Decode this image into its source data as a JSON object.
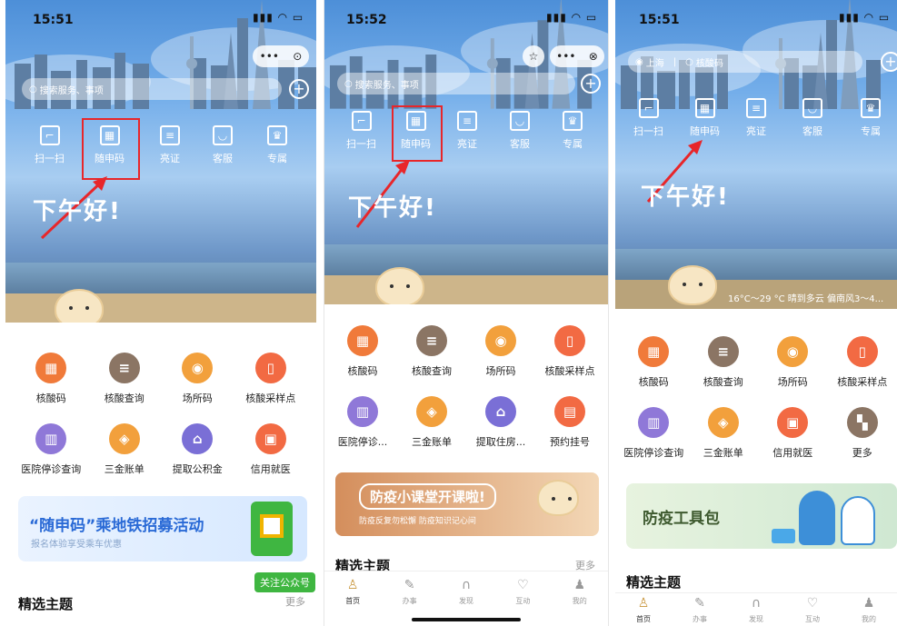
{
  "colors": {
    "highlight": "#e8262a",
    "follow_green": "#3fb641",
    "icon_orange": "#f07a3a",
    "icon_brown": "#8b7564",
    "icon_amber": "#f2a03c",
    "icon_purple": "#8f78d8",
    "icon_red_orange": "#f26a43"
  },
  "phones": [
    {
      "status_time": "15:51",
      "capsule": [
        "•••",
        "⊙"
      ],
      "search_placeholder": "搜索服务、事项",
      "quick_actions": [
        "扫一扫",
        "随申码",
        "亮证",
        "客服",
        "专属"
      ],
      "greeting": "下午好!",
      "grid": [
        "核酸码",
        "核酸查询",
        "场所码",
        "核酸采样点",
        "医院停诊查询",
        "三金账单",
        "提取公积金",
        "信用就医"
      ],
      "banner": {
        "title": "“随申码”乘地铁招募活动",
        "subtitle": "报名体验享受乘车优惠"
      },
      "follow": "关注公众号",
      "section_title": "精选主题",
      "more": "更多"
    },
    {
      "status_time": "15:52",
      "capsule": [
        "☆",
        "•••",
        "⊗"
      ],
      "search_placeholder": "搜索服务、事项",
      "quick_actions": [
        "扫一扫",
        "随申码",
        "亮证",
        "客服",
        "专属"
      ],
      "greeting": "下午好!",
      "grid": [
        "核酸码",
        "核酸查询",
        "场所码",
        "核酸采样点",
        "医院停诊...",
        "三金账单",
        "提取住房...",
        "预约挂号"
      ],
      "banner": {
        "title": "防疫小课堂开课啦!",
        "subtitle": "防疫反复勿松懈 防疫知识记心间"
      },
      "section_title": "精选主题",
      "more": "更多",
      "tabs": [
        "首页",
        "办事",
        "发现",
        "互动",
        "我的"
      ]
    },
    {
      "status_time": "15:51",
      "location": "上海",
      "search_placeholder": "核酸码",
      "quick_actions": [
        "扫一扫",
        "随申码",
        "亮证",
        "客服",
        "专属"
      ],
      "greeting": "下午好!",
      "weather": "16°C～29 °C 晴到多云 偏南风3～4...",
      "grid": [
        "核酸码",
        "核酸查询",
        "场所码",
        "核酸采样点",
        "医院停诊查询",
        "三金账单",
        "信用就医",
        "更多"
      ],
      "banner": {
        "title": "防疫工具包"
      },
      "section_title": "精选主题",
      "tabs": [
        "首页",
        "办事",
        "发现",
        "互动",
        "我的"
      ]
    }
  ]
}
